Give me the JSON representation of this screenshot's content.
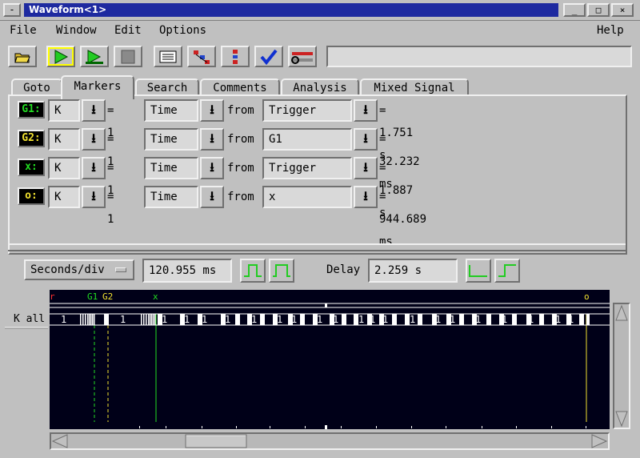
{
  "window": {
    "title": "Waveform<1>",
    "sys_button": "-",
    "minimize": "_",
    "maximize": "□",
    "close": "×"
  },
  "menu": {
    "file": "File",
    "window": "Window",
    "edit": "Edit",
    "options": "Options",
    "help": "Help"
  },
  "toolbar": {
    "buttons": [
      "open-folder-icon",
      "run-single-icon",
      "run-repetitive-icon",
      "stop-icon",
      "listing-icon",
      "navigator-icon",
      "overview-icon",
      "checkmark-icon",
      "setup-tools-icon"
    ],
    "status_text": ""
  },
  "tabs": [
    "Goto",
    "Markers",
    "Search",
    "Comments",
    "Analysis",
    "Mixed Signal"
  ],
  "selected_tab": "Markers",
  "markers": [
    {
      "name": "G1:",
      "color": "#22dd22",
      "label": "K",
      "eq": "= 1",
      "mode": "Time",
      "from_label": "from",
      "ref": "Trigger",
      "value": "= 1.751 s"
    },
    {
      "name": "G2:",
      "color": "#f0e030",
      "label": "K",
      "eq": "= 1",
      "mode": "Time",
      "from_label": "from",
      "ref": "G1",
      "value": "= 32.232 ms"
    },
    {
      "name": "x:",
      "color": "#22dd22",
      "label": "K",
      "eq": "= 1",
      "mode": "Time",
      "from_label": "from",
      "ref": "Trigger",
      "value": "= 1.887 s"
    },
    {
      "name": "o:",
      "color": "#f0e030",
      "label": "K",
      "eq": "= 1",
      "mode": "Time",
      "from_label": "from",
      "ref": "x",
      "value": "= 944.689 ms"
    }
  ],
  "timebase": {
    "mode": "Seconds/div",
    "seconds_per_div": "120.955 ms",
    "delay_label": "Delay",
    "delay": "2.259 s"
  },
  "waveform": {
    "bus_label": "K all",
    "marker_labels": {
      "trigger": "r",
      "g1": "G1",
      "g2": "G2",
      "x": "x",
      "o": "o"
    },
    "bus_values": [
      "1",
      "1",
      "1",
      "1",
      "1",
      "1",
      "1",
      "1",
      "1",
      "1",
      "1",
      "1",
      "1",
      "1",
      "1",
      "1",
      "1",
      "1",
      "1",
      "1",
      "1",
      "1"
    ],
    "colors": {
      "background": "#000018",
      "trace": "#ffffff",
      "g1": "#22dd22",
      "g2": "#f0e030",
      "x": "#22dd22",
      "o": "#f0e030",
      "trigger": "#ff3030"
    }
  }
}
